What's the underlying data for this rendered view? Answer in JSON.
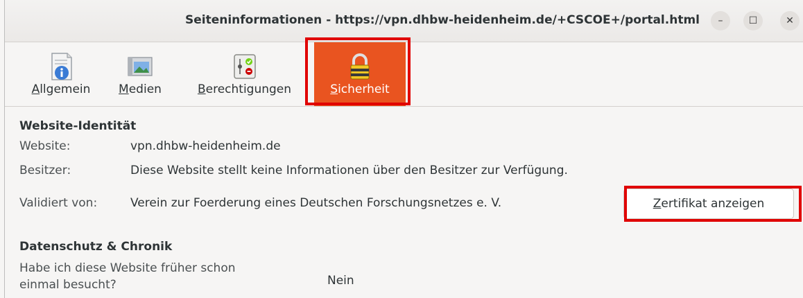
{
  "window": {
    "title": "Seiteninformationen - https://vpn.dhbw-heidenheim.de/+CSCOE+/portal.html",
    "min_glyph": "–",
    "max_glyph": "☐",
    "close_glyph": "✕"
  },
  "tabs": [
    {
      "first": "A",
      "rest": "llgemein",
      "icon": "info-page-icon"
    },
    {
      "first": "M",
      "rest": "edien",
      "icon": "media-icon"
    },
    {
      "first": "B",
      "rest": "erechtigungen",
      "icon": "permissions-icon"
    },
    {
      "first": "S",
      "rest": "icherheit",
      "icon": "lock-icon",
      "active": true
    }
  ],
  "identity": {
    "heading": "Website-Identität",
    "website_label": "Website:",
    "website_value": "vpn.dhbw-heidenheim.de",
    "owner_label": "Besitzer:",
    "owner_value": "Diese Website stellt keine Informationen über den Besitzer zur Verfügung.",
    "validated_label": "Validiert von:",
    "validated_value": "Verein zur Foerderung eines Deutschen Forschungsnetzes e. V.",
    "cert_button_first": "Z",
    "cert_button_rest": "ertifikat anzeigen"
  },
  "privacy": {
    "heading": "Datenschutz & Chronik",
    "visited_label_line1": "Habe ich diese Website früher schon",
    "visited_label_line2": "einmal besucht?",
    "visited_value": "Nein"
  },
  "colors": {
    "accent": "#e95420",
    "highlight": "#e00000"
  }
}
